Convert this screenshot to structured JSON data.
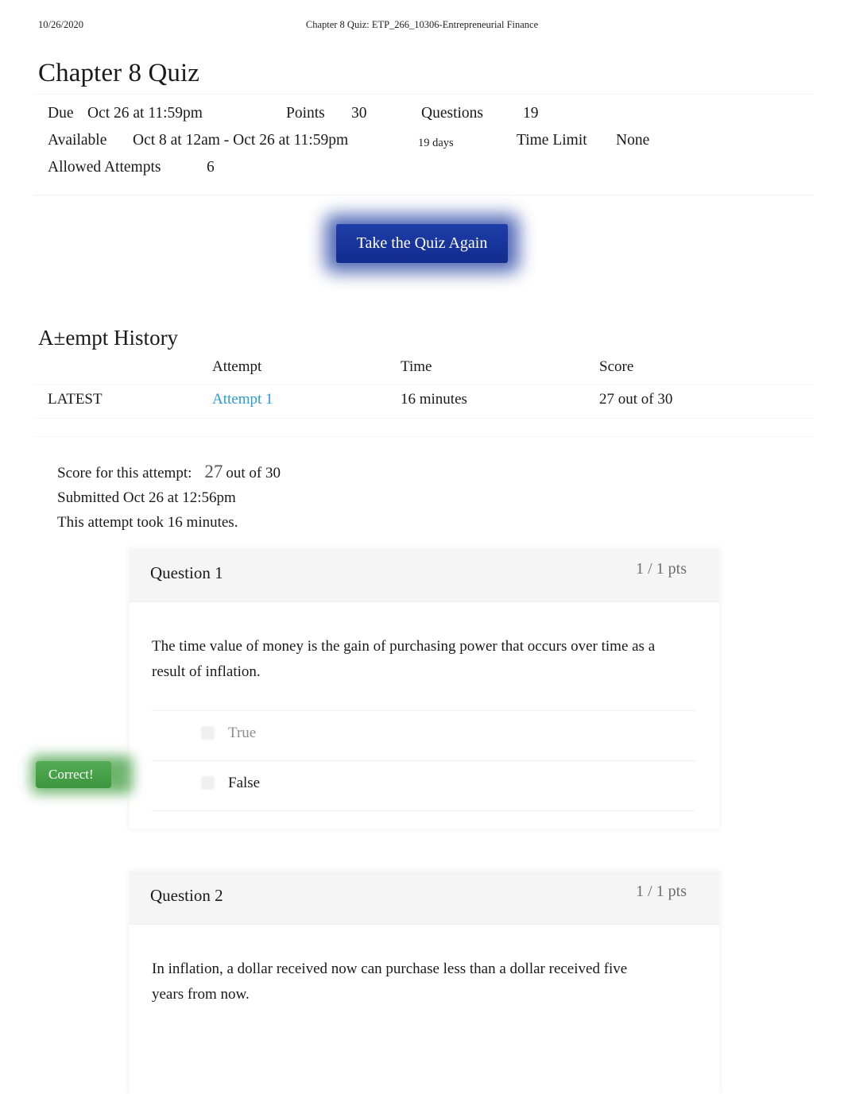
{
  "print_header": {
    "date": "10/26/2020",
    "document_title": "Chapter 8 Quiz: ETP_266_10306-Entrepreneurial Finance"
  },
  "page_title": "Chapter 8 Quiz",
  "quiz_info": {
    "due_label": "Due",
    "due_value": "Oct 26 at 11:59pm",
    "points_label": "Points",
    "points_value": "30",
    "questions_label": "Questions",
    "questions_value": "19",
    "available_label": "Available",
    "available_value": "Oct 8 at 12am - Oct 26 at 11:59pm",
    "available_duration": "19 days",
    "time_limit_label": "Time Limit",
    "time_limit_value": "None",
    "allowed_attempts_label": "Allowed Attempts",
    "allowed_attempts_value": "6"
  },
  "take_quiz_button": "Take the Quiz Again",
  "attempt_history": {
    "heading": "A±empt History",
    "columns": {
      "kept": "",
      "attempt": "Attempt",
      "time": "Time",
      "score": "Score"
    },
    "rows": [
      {
        "kept": "LATEST",
        "attempt": "Attempt 1",
        "time": "16 minutes",
        "score": "27 out of 30"
      }
    ]
  },
  "score_summary": {
    "score_label": "Score for this attempt:",
    "score_value": "27",
    "score_suffix": "out of 30",
    "submitted": "Submitted Oct 26 at 12:56pm",
    "duration": "This attempt took 16 minutes."
  },
  "questions": [
    {
      "title": "Question 1",
      "points": "1 / 1 pts",
      "text": "The time value of money is the gain of purchasing power that occurs over time as a result of inflation.",
      "answers": [
        {
          "label": "True",
          "selected": false
        },
        {
          "label": "False",
          "selected": true
        }
      ],
      "feedback_badge": "Correct!"
    },
    {
      "title": "Question 2",
      "points": "1 / 1 pts",
      "text": "In inflation, a dollar received now can purchase less than a dollar received five years from now.",
      "answers": [],
      "feedback_badge": ""
    }
  ],
  "colors": {
    "button_blue": "#17349a",
    "link_blue": "#2b9ad8",
    "correct_green": "#46a046",
    "points_grey": "#6d6d6d",
    "header_grey": "#f5f5f5"
  }
}
